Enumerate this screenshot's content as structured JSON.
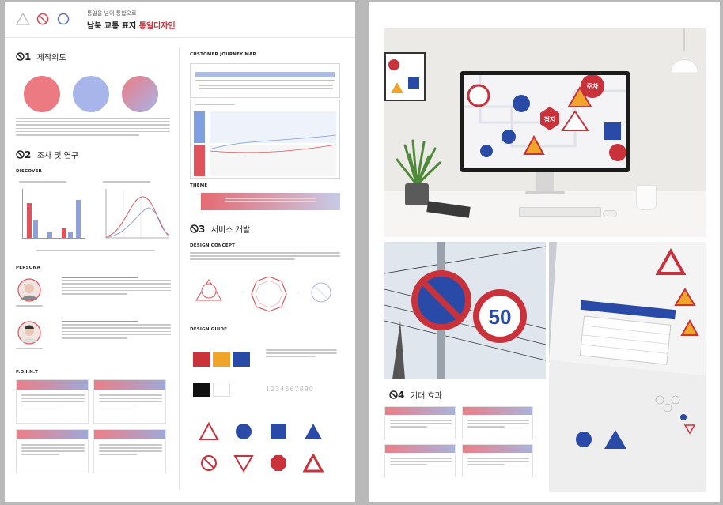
{
  "header": {
    "subtitle": "통일을 넘어 통합으로",
    "title_plain": "남북 교통 표지 ",
    "title_accent": "통일디자인"
  },
  "sections": {
    "s1": {
      "num": "1",
      "title": "제작의도"
    },
    "s2": {
      "num": "2",
      "title": "조사 및 연구"
    },
    "s3": {
      "num": "3",
      "title": "서비스 개발"
    },
    "s4": {
      "num": "4",
      "title": "기대 효과"
    }
  },
  "labels": {
    "discover": "DISCOVER",
    "persona": "PERSONA",
    "point": "P.O.I.N.T",
    "customer_journey": "CUSTOMER JOURNEY MAP",
    "theme": "THEME",
    "design_concept": "DESIGN CONCEPT",
    "design_guide": "DESIGN GUIDE"
  },
  "number_sample": "1234567890",
  "photo_texts": {
    "sign_stop": "정지",
    "sign_parking": "주차",
    "sign_speed": "50"
  },
  "colors": {
    "accent_red": "#e0535c",
    "accent_blue": "#8f9fd8",
    "sign_red": "#c9313b",
    "sign_blue": "#2a4aa8",
    "sign_yellow": "#f0a52a"
  }
}
